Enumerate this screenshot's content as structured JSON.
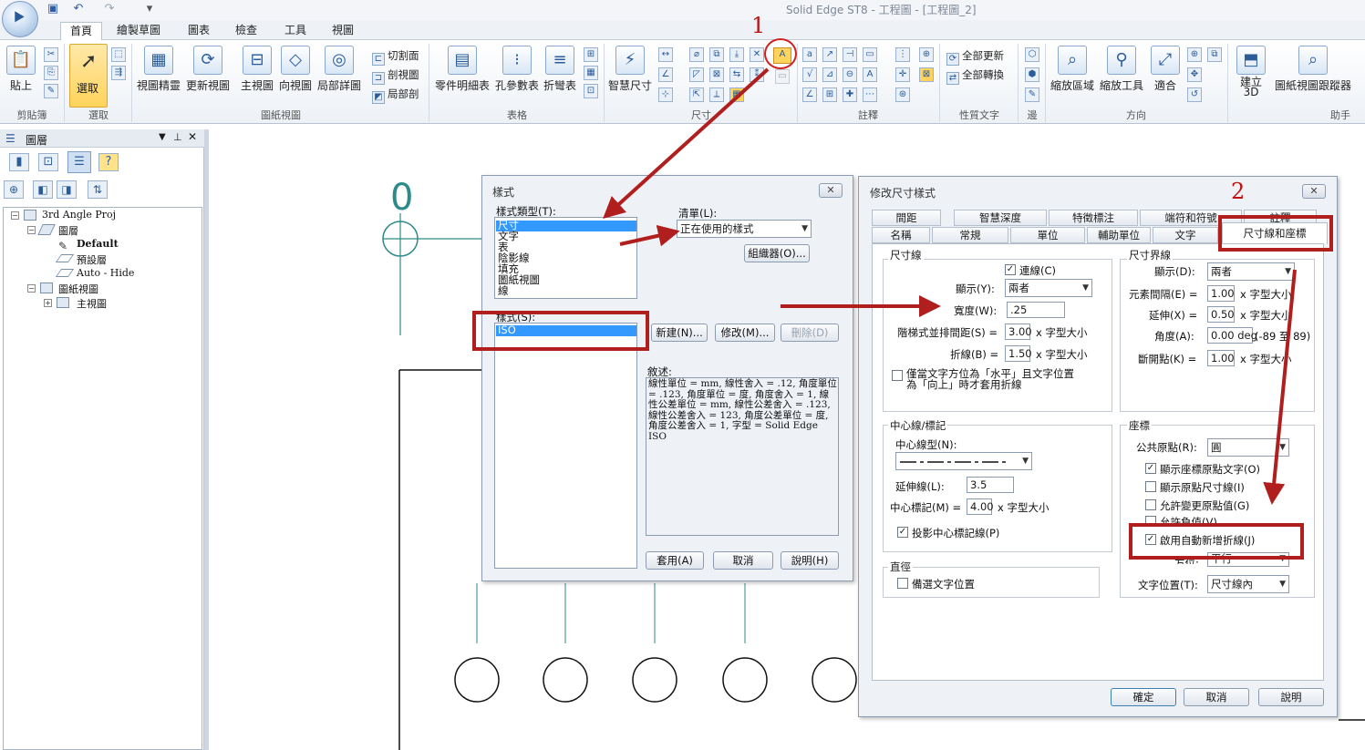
{
  "window_title": "Solid Edge ST8 - 工程圖 - [工程圖_2]",
  "ribbon_tabs": [
    "首頁",
    "繪製草圖",
    "圖表",
    "檢查",
    "工具",
    "視圖"
  ],
  "ribbon": {
    "paste": "貼上",
    "clipboard_group": "剪貼簿",
    "select": "選取",
    "select_group": "選取",
    "view_wizard": "視圖精靈",
    "update_views": "更新視圖",
    "principal_view": "主視圖",
    "auxiliary_view": "向視圖",
    "detail_view": "局部詳圖",
    "section_plane": "切割面",
    "section_view": "剖視圖",
    "broken_out": "局部剖",
    "drawing_views_group": "圖紙視圖",
    "parts_list": "零件明細表",
    "hole_table": "孔參數表",
    "bend_table": "折彎表",
    "tables_group": "表格",
    "smart_dimension": "智慧尺寸",
    "dimension_group": "尺寸",
    "annotation_group": "註釋",
    "update_all": "全部更新",
    "convert_all": "全部轉換",
    "property_text_group": "性質文字",
    "edge_group": "邊",
    "zoom_area": "縮放區域",
    "zoom_tool": "縮放工具",
    "fit": "適合",
    "orient_group": "方向",
    "create_3d": "建立\n3D",
    "drawing_view_tracker": "圖紙視圖跟蹤器",
    "assistant_group": "助手"
  },
  "left_panel": {
    "title": "圖層",
    "tree": [
      {
        "label": "3rd Angle Proj",
        "level": 0,
        "expander": "-"
      },
      {
        "label": "圖層",
        "level": 1,
        "expander": "-"
      },
      {
        "label": "Default",
        "level": 2,
        "bold": true
      },
      {
        "label": "預設層",
        "level": 2
      },
      {
        "label": "Auto - Hide",
        "level": 2
      },
      {
        "label": "圖紙視圖",
        "level": 1,
        "expander": "-"
      },
      {
        "label": "主視圖",
        "level": 2,
        "expander": "+"
      }
    ]
  },
  "style_dialog": {
    "title": "樣式",
    "close": "✕",
    "style_type_label": "樣式類型(T):",
    "style_types": [
      "尺寸",
      "文字",
      "表",
      "陰影線",
      "填充",
      "圖紙視圖",
      "線"
    ],
    "list_label": "清單(L):",
    "list_value": "正在使用的樣式",
    "organizer": "組織器(O)...",
    "styles_label": "樣式(S):",
    "styles": [
      "ISO"
    ],
    "new": "新建(N)...",
    "modify": "修改(M)...",
    "delete": "刪除(D)",
    "description_label": "敘述:",
    "description": "線性單位 = mm, 線性舍入 = .12, 角度單位 = .123, 角度單位 = 度, 角度舍入 = 1, 線性公差單位 = mm, 線性公差舍入 = .123, 線性公差舍入 = 123, 角度公差單位 = 度, 角度公差舍入 = 1, 字型 = Solid Edge ISO",
    "apply": "套用(A)",
    "cancel": "取消",
    "help": "說明(H)"
  },
  "modify_dialog": {
    "title": "修改尺寸樣式",
    "close": "✕",
    "tabs_row1": [
      "間距",
      "智慧深度",
      "特徵標注",
      "端符和符號",
      "註釋"
    ],
    "tabs_row2": [
      "名稱",
      "常規",
      "單位",
      "輔助單位",
      "文字",
      "尺寸線和座標"
    ],
    "dim_line": {
      "title": "尺寸線",
      "connect_line": "連線(C)",
      "display_label": "顯示(Y):",
      "display_value": "兩者",
      "width_label": "寬度(W):",
      "width_value": ".25",
      "stack_label": "階梯式並排間距(S) =",
      "stack_value": "3.00",
      "break_label": "折線(B) =",
      "break_value": "1.50",
      "unit_suffix": "x 字型大小",
      "horizontal_only": "僅當文字方位為「水平」且文字位置\n為「向上」時才套用折線"
    },
    "projection_line": {
      "title": "尺寸界線",
      "display_label": "顯示(D):",
      "display_value": "兩者",
      "gap_label": "元素間隔(E) =",
      "gap_value": "1.00",
      "extend_label": "延伸(X) =",
      "extend_value": "0.50",
      "angle_label": "角度(A):",
      "angle_value": "0.00 deg",
      "angle_range": "(-89 至 89)",
      "break_label": "斷開點(K) =",
      "break_value": "1.00",
      "unit_suffix": "x 字型大小"
    },
    "centerline": {
      "title": "中心線/標記",
      "type_label": "中心線型(N):",
      "ext_label": "延伸線(L):",
      "ext_value": "3.5",
      "mark_label": "中心標記(M) =",
      "mark_value": "4.00",
      "unit_suffix": "x 字型大小",
      "project_marks": "投影中心標記線(P)"
    },
    "diameter": {
      "title": "直徑",
      "alt_text_pos": "備選文字位置"
    },
    "coordinate": {
      "title": "座標",
      "origin_label": "公共原點(R):",
      "origin_value": "圓",
      "show_origin_text": "顯示座標原點文字(O)",
      "show_origin_dim": "顯示原點尺寸線(I)",
      "allow_origin_change": "允許變更原點值(G)",
      "allow_negative": "允許負值(V)",
      "auto_jog": "啟用自動新增折線(J)",
      "orientation_label": "方位:",
      "orientation_value": "平行",
      "text_pos_label": "文字位置(T):",
      "text_pos_value": "尺寸線內"
    },
    "ok": "確定",
    "cancel": "取消",
    "help": "說明"
  },
  "drawing": {
    "view_label": "0"
  },
  "annotations": {
    "step1": "1",
    "step2": "2",
    "color": "#b01e1e"
  }
}
